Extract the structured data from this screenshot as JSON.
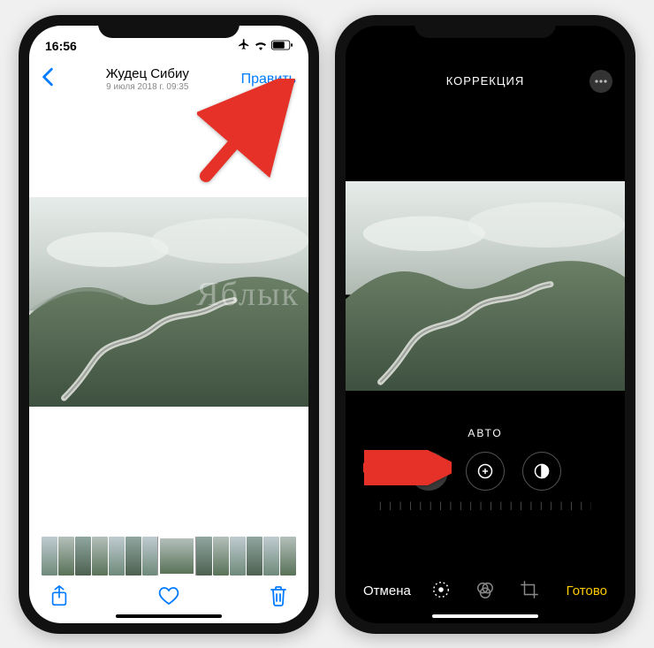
{
  "left": {
    "status": {
      "time": "16:56"
    },
    "header": {
      "title": "Жудец Сибиу",
      "subtitle": "9 июля 2018 г.  09:35",
      "edit": "Править"
    },
    "watermark": "Яблык",
    "thumbs": 14
  },
  "right": {
    "header": {
      "title": "КОРРЕКЦИЯ"
    },
    "edit_mode": "АВТО",
    "wand_label": "Авто",
    "exposure_label": "Экспозиция",
    "contrast_label": "Контраст",
    "cancel": "Отмена",
    "done": "Готово"
  },
  "colors": {
    "ios_blue": "#007aff",
    "ios_yellow": "#ffcc00",
    "arrow": "#e53127"
  }
}
